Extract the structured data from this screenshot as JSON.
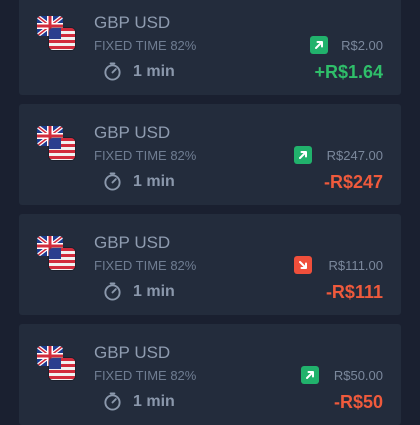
{
  "colors": {
    "up": "#21b26c",
    "down": "#ef4f3b",
    "profit": "#2fbf6a",
    "loss": "#ef5a3c"
  },
  "trades": [
    {
      "pair": "GBP USD",
      "mode": "FIXED TIME 82%",
      "duration": "1 min",
      "direction": "up",
      "amount": "R$2.00",
      "result": "+R$1.64",
      "outcome": "profit"
    },
    {
      "pair": "GBP USD",
      "mode": "FIXED TIME 82%",
      "duration": "1 min",
      "direction": "up",
      "amount": "R$247.00",
      "result": "-R$247",
      "outcome": "loss"
    },
    {
      "pair": "GBP USD",
      "mode": "FIXED TIME 82%",
      "duration": "1 min",
      "direction": "down",
      "amount": "R$111.00",
      "result": "-R$111",
      "outcome": "loss"
    },
    {
      "pair": "GBP USD",
      "mode": "FIXED TIME 82%",
      "duration": "1 min",
      "direction": "up",
      "amount": "R$50.00",
      "result": "-R$50",
      "outcome": "loss"
    }
  ]
}
